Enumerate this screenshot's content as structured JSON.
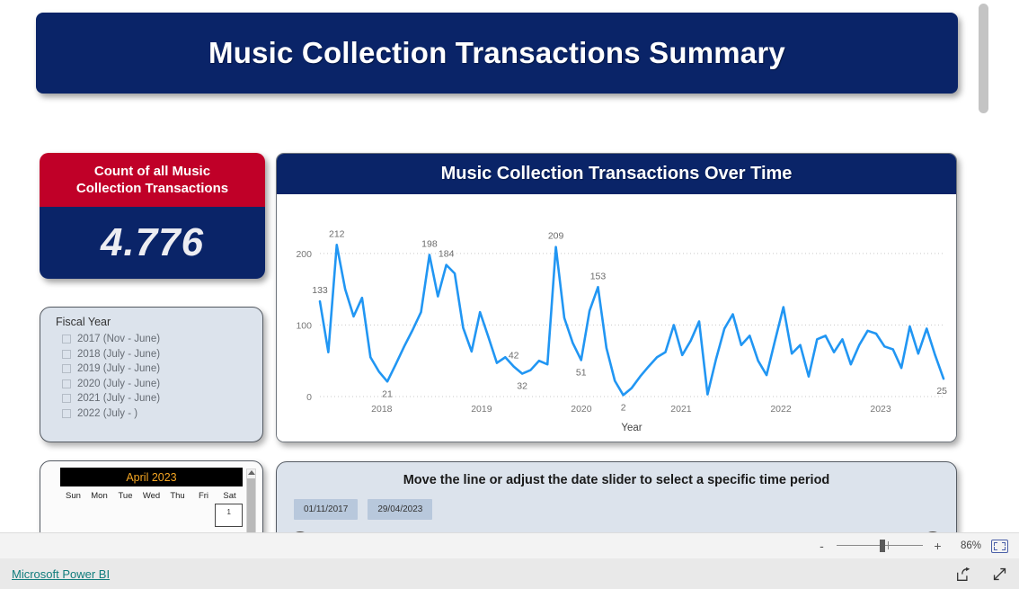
{
  "report": {
    "title": "Music Collection Transactions Summary"
  },
  "kpi": {
    "label_line1": "Count of all Music",
    "label_line2": "Collection Transactions",
    "value": "4.776",
    "header_color": "#C00028",
    "body_color": "#0A2468"
  },
  "slicer": {
    "title": "Fiscal Year",
    "items": [
      {
        "label": "2017 (Nov - June)",
        "checked": false
      },
      {
        "label": "2018 (July - June)",
        "checked": false
      },
      {
        "label": "2019 (July - June)",
        "checked": false
      },
      {
        "label": "2020 (July - June)",
        "checked": false
      },
      {
        "label": "2021 (July - June)",
        "checked": false
      },
      {
        "label": "2022 (July - )",
        "checked": false
      }
    ]
  },
  "calendar": {
    "month_label": "April 2023",
    "day_headers": [
      "Sun",
      "Mon",
      "Tue",
      "Wed",
      "Thu",
      "Fri",
      "Sat"
    ],
    "first_visible_day": "1"
  },
  "slider_panel": {
    "instruction": "Move the line or adjust the date slider to select a specific time period",
    "start_date": "01/11/2017",
    "end_date": "29/04/2023"
  },
  "statusbar": {
    "zoom_minus": "-",
    "zoom_plus": "+",
    "zoom_level": "86%",
    "fit_icon": "fit-to-page-icon"
  },
  "footer": {
    "brand": "Microsoft Power BI",
    "share_icon": "share-icon",
    "fullscreen_icon": "fullscreen-icon"
  },
  "chart_data": {
    "type": "line",
    "title": "Music Collection Transactions Over Time",
    "xlabel": "Year",
    "ylabel": "",
    "ylim": [
      0,
      230
    ],
    "yticks": [
      0,
      100,
      200
    ],
    "xticks": [
      "2018",
      "2019",
      "2020",
      "2021",
      "2022",
      "2023"
    ],
    "grid": true,
    "line_color": "#2196F3",
    "legend": "none",
    "x_start": "2017-11",
    "x_end": "2023-04",
    "point_interval": "month",
    "labeled_points": [
      {
        "label": "133",
        "value": 133
      },
      {
        "label": "212",
        "value": 212
      },
      {
        "label": "198",
        "value": 198
      },
      {
        "label": "184",
        "value": 184
      },
      {
        "label": "21",
        "value": 21
      },
      {
        "label": "42",
        "value": 42
      },
      {
        "label": "32",
        "value": 32
      },
      {
        "label": "209",
        "value": 209
      },
      {
        "label": "153",
        "value": 153
      },
      {
        "label": "51",
        "value": 51
      },
      {
        "label": "2",
        "value": 2
      },
      {
        "label": "25",
        "value": 25
      }
    ],
    "values": [
      133,
      62,
      212,
      150,
      112,
      138,
      55,
      35,
      21,
      45,
      70,
      93,
      118,
      198,
      140,
      184,
      172,
      96,
      63,
      118,
      83,
      47,
      55,
      42,
      32,
      37,
      50,
      45,
      209,
      110,
      75,
      51,
      120,
      153,
      68,
      22,
      2,
      12,
      28,
      42,
      55,
      62,
      100,
      58,
      78,
      105,
      3,
      52,
      95,
      115,
      72,
      85,
      50,
      30,
      78,
      125,
      60,
      72,
      28,
      80,
      85,
      62,
      80,
      45,
      72,
      92,
      88,
      70,
      66,
      40,
      98,
      60,
      95,
      58,
      25
    ]
  }
}
